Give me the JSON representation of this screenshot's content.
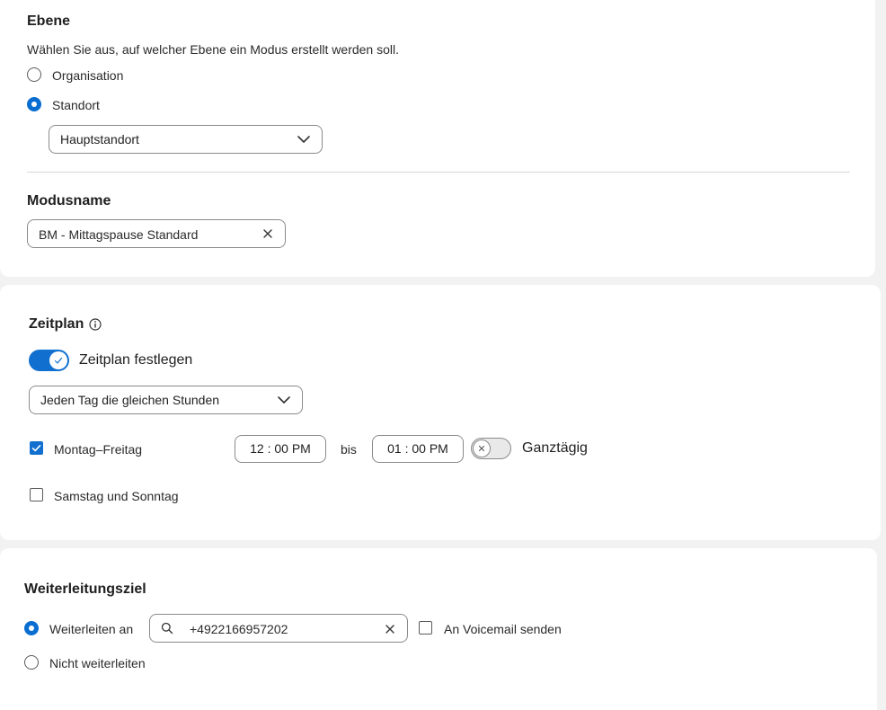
{
  "ebene": {
    "heading": "Ebene",
    "description": "Wählen Sie aus, auf welcher Ebene ein Modus erstellt werden soll.",
    "options": [
      {
        "label": "Organisation",
        "checked": false
      },
      {
        "label": "Standort",
        "checked": true
      }
    ],
    "location_select": {
      "value": "Hauptstandort"
    }
  },
  "modusname": {
    "heading": "Modusname",
    "value": "BM - Mittagspause Standard"
  },
  "zeitplan": {
    "heading": "Zeitplan",
    "toggle_label": "Zeitplan festlegen",
    "toggle_on": true,
    "schedule_select": {
      "value": "Jeden Tag die gleichen Stunden"
    },
    "weekday": {
      "label": "Montag–Freitag",
      "checked": true,
      "start": "12 : 00 PM",
      "separator": "bis",
      "end": "01 : 00 PM",
      "allday_label": "Ganztägig",
      "allday_on": false
    },
    "weekend": {
      "label": "Samstag und Sonntag",
      "checked": false
    }
  },
  "weiterleitung": {
    "heading": "Weiterleitungsziel",
    "options": [
      {
        "label": "Weiterleiten an",
        "checked": true
      },
      {
        "label": "Nicht weiterleiten",
        "checked": false
      }
    ],
    "number_value": "+4922166957202",
    "voicemail_label": "An Voicemail senden",
    "voicemail_checked": false
  },
  "colors": {
    "accent": "#1170cf",
    "border": "#8a8a8a",
    "background": "#f2f2f2"
  }
}
